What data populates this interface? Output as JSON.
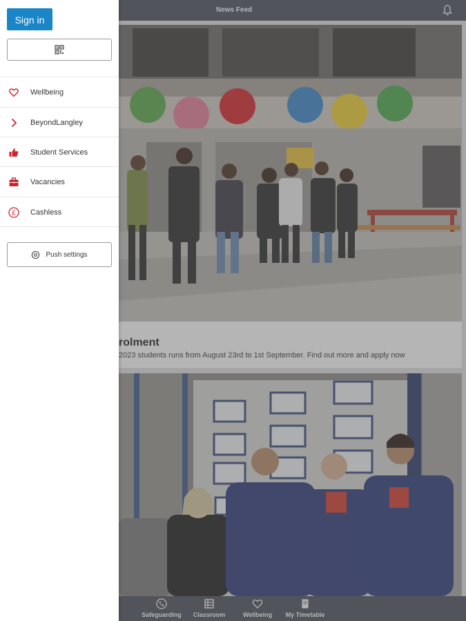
{
  "header": {
    "title": "News Feed",
    "bell_icon": "bell-icon"
  },
  "feed": {
    "cards": [
      {
        "title": "rolment",
        "text": "2023 students runs from August 23rd to 1st September. Find out more and apply now"
      },
      {
        "title": "",
        "text": ""
      }
    ]
  },
  "bottom_nav": [
    {
      "label": "Safeguarding",
      "icon": "phone-icon"
    },
    {
      "label": "Classroom",
      "icon": "grid-icon"
    },
    {
      "label": "Wellbeing",
      "icon": "heart-icon"
    },
    {
      "label": "My Timetable",
      "icon": "document-icon"
    }
  ],
  "drawer": {
    "sign_in_label": "Sign in",
    "qr_icon": "qr-code-icon",
    "items": [
      {
        "label": "Wellbeing",
        "icon": "heart-icon"
      },
      {
        "label": "BeyondLangley",
        "icon": "chevron-right-icon"
      },
      {
        "label": "Student Services",
        "icon": "thumbs-up-icon"
      },
      {
        "label": "Vacancies",
        "icon": "briefcase-icon"
      },
      {
        "label": "Cashless",
        "icon": "pound-icon"
      }
    ],
    "push_settings_label": "Push settings"
  },
  "colors": {
    "accent": "#1a86c8",
    "icon_red": "#d0212f",
    "bar": "#4a4f5a"
  }
}
